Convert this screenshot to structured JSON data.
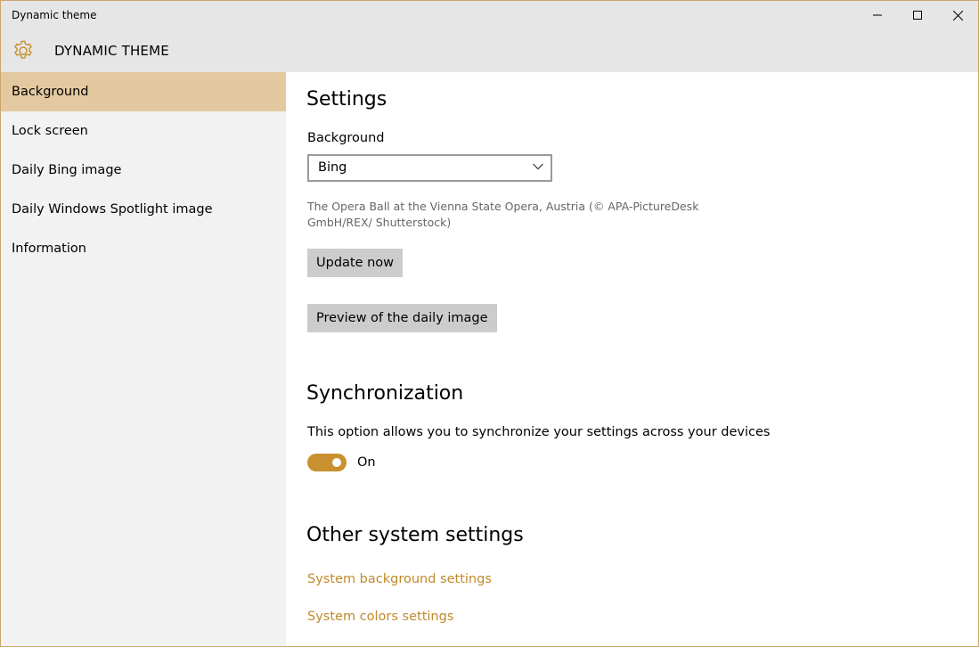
{
  "window": {
    "title": "Dynamic theme",
    "minimize_icon": "minimize-icon",
    "maximize_icon": "maximize-icon",
    "close_icon": "close-icon"
  },
  "header": {
    "icon": "gear-icon",
    "title": "DYNAMIC THEME"
  },
  "sidebar": {
    "items": [
      {
        "label": "Background",
        "selected": true
      },
      {
        "label": "Lock screen",
        "selected": false
      },
      {
        "label": "Daily Bing image",
        "selected": false
      },
      {
        "label": "Daily Windows Spotlight image",
        "selected": false
      },
      {
        "label": "Information",
        "selected": false
      }
    ]
  },
  "settings": {
    "heading": "Settings",
    "background_label": "Background",
    "background_value": "Bing",
    "image_caption": "The Opera Ball at the Vienna State Opera, Austria (© APA-PictureDesk GmbH/REX/ Shutterstock)",
    "update_button": "Update now",
    "preview_button": "Preview of the daily image"
  },
  "sync": {
    "heading": "Synchronization",
    "description": "This option allows you to synchronize your settings across your devices",
    "toggle_state": "On",
    "toggle_on": true
  },
  "other": {
    "heading": "Other system settings",
    "links": [
      "System background settings",
      "System colors settings"
    ]
  },
  "colors": {
    "accent": "#c8902e",
    "selected_nav": "#e4c9a0",
    "link": "#c08a2c"
  }
}
